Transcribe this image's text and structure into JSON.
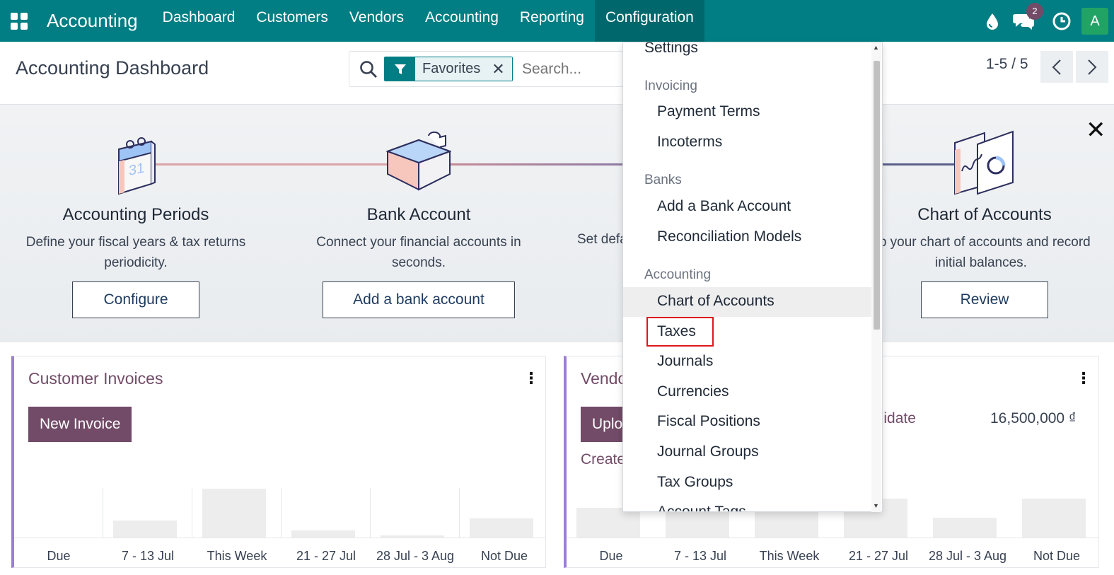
{
  "navbar": {
    "brand": "Accounting",
    "menu": [
      "Dashboard",
      "Customers",
      "Vendors",
      "Accounting",
      "Reporting",
      "Configuration"
    ],
    "message_count": "2",
    "avatar_letter": "A",
    "bg_color": "#017e84"
  },
  "control_panel": {
    "title": "Accounting Dashboard",
    "facet_label": "Favorites",
    "search_placeholder": "Search...",
    "pager": "1-5 / 5"
  },
  "banner": {
    "steps": [
      {
        "title": "Accounting Periods",
        "desc_line1": "Define your fiscal years & tax returns",
        "desc_line2": "periodicity.",
        "button": "Configure",
        "icon": "calendar-icon"
      },
      {
        "title": "Bank Account",
        "desc_line1": "Connect your financial accounts in",
        "desc_line2": "seconds.",
        "button": "Add a bank account",
        "icon": "puzzle-icon"
      },
      {
        "title": "",
        "desc_line1": "Set defa",
        "desc_line2": "",
        "button": "",
        "icon": ""
      },
      {
        "title": "Chart of Accounts",
        "desc_line1": "up your chart of accounts and record",
        "desc_line2": "initial balances.",
        "button": "Review",
        "icon": "chart-icon"
      }
    ]
  },
  "cards": {
    "customer": {
      "title": "Customer Invoices",
      "button": "New Invoice",
      "x_labels": [
        "Due",
        "7 - 13 Jul",
        "This Week",
        "21 - 27 Jul",
        "28 Jul - 3 Aug",
        "Not Due"
      ]
    },
    "vendor": {
      "title": "Vendo",
      "button": "Uplo",
      "link": "Create",
      "validate_label": "alidate",
      "amount": "16,500,000 ₫",
      "x_labels": [
        "Due",
        "7 - 13 Jul",
        "This Week",
        "21 - 27 Jul",
        "28 Jul - 3 Aug",
        "Not Due"
      ]
    }
  },
  "dropdown": {
    "settings": "Settings",
    "sections": {
      "invoicing": "Invoicing",
      "banks": "Banks",
      "accounting": "Accounting"
    },
    "invoicing_items": [
      "Payment Terms",
      "Incoterms"
    ],
    "banks_items": [
      "Add a Bank Account",
      "Reconciliation Models"
    ],
    "accounting_items": [
      "Chart of Accounts",
      "Taxes",
      "Journals",
      "Currencies",
      "Fiscal Positions",
      "Journal Groups",
      "Tax Groups",
      "Account Tags"
    ]
  }
}
